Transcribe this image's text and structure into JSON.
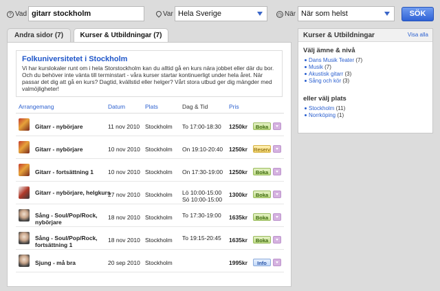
{
  "search": {
    "what_label": "Vad",
    "what_value": "gitarr stockholm",
    "where_label": "Var",
    "where_value": "Hela Sverige",
    "when_label": "När",
    "when_value": "När som helst",
    "submit_label": "SÖK"
  },
  "tabs": [
    {
      "label": "Andra sidor (7)"
    },
    {
      "label": "Kurser & Utbildningar (7)"
    }
  ],
  "info": {
    "title": "Folkuniversitetet i Stockholm",
    "text": "Vi har kurslokaler runt om i hela Storstockholm kan du alltid gå en kurs nära jobbet eller där du bor. Och du behöver inte vänta till terminstart - våra kurser startar kontinuerligt under hela året. När passar det dig att gå en kurs? Dagtid, kvällstid eller helger? Vårt stora utbud ger dig mängder med valmöjligheter!"
  },
  "table": {
    "headers": [
      "Arrangemang",
      "Datum",
      "Plats",
      "Dag & Tid",
      "Pris"
    ],
    "rows": [
      {
        "name": "Gitarr - nybörjare",
        "date": "11 nov 2010",
        "place": "Stockholm",
        "time": "To 17:00-18:30",
        "price": "1250kr",
        "action": "Boka",
        "type": "guitar"
      },
      {
        "name": "Gitarr - nybörjare",
        "date": "10 nov 2010",
        "place": "Stockholm",
        "time": "On 19:10-20:40",
        "price": "1250kr",
        "action": "Reserv",
        "type": "guitar"
      },
      {
        "name": "Gitarr - fortsättning 1",
        "date": "10 nov 2010",
        "place": "Stockholm",
        "time": "On 17:30-19:00",
        "price": "1250kr",
        "action": "Boka",
        "type": "guitar"
      },
      {
        "name": "Gitarr - nybörjare, helgkurs",
        "date": "27 nov 2010",
        "place": "Stockholm",
        "time": "Lö 10:00-15:00",
        "time2": "Sö 10:00-15:00",
        "price": "1300kr",
        "action": "Boka",
        "type": "guitar2"
      },
      {
        "name": "Sång - Soul/Pop/Rock,",
        "name2": "nybörjare",
        "date": "18 nov 2010",
        "place": "Stockholm",
        "time": "To 17:30-19:00",
        "price": "1635kr",
        "action": "Boka",
        "type": "sing"
      },
      {
        "name": "Sång - Soul/Pop/Rock,",
        "name2": "fortsättning 1",
        "date": "18 nov 2010",
        "place": "Stockholm",
        "time": "To 19:15-20:45",
        "price": "1635kr",
        "action": "Boka",
        "type": "sing"
      },
      {
        "name": "Sjung - må bra",
        "date": "20 sep 2010",
        "place": "Stockholm",
        "time": "",
        "price": "1995kr",
        "action": "Info",
        "type": "sing"
      }
    ]
  },
  "sidebar": {
    "title": "Kurser & Utbildningar",
    "view_all": "Visa alla",
    "subject_heading": "Välj ämne & nivå",
    "subjects": [
      {
        "label": "Dans Musik Teater",
        "count": "(7)"
      },
      {
        "label": "Musik",
        "count": "(7)"
      },
      {
        "label": "Akustisk gitarr",
        "count": "(3)"
      },
      {
        "label": "Sång och kör",
        "count": "(3)"
      }
    ],
    "place_heading": "eller välj plats",
    "places": [
      {
        "label": "Stockholm",
        "count": "(11)"
      },
      {
        "label": "Norrköping",
        "count": "(1)"
      }
    ]
  },
  "colors": {
    "accent": "#1f56c9",
    "button": "#2f62d6",
    "boka": "#bfdc86",
    "reserv": "#f4d46a",
    "info": "#c2d8f8"
  }
}
